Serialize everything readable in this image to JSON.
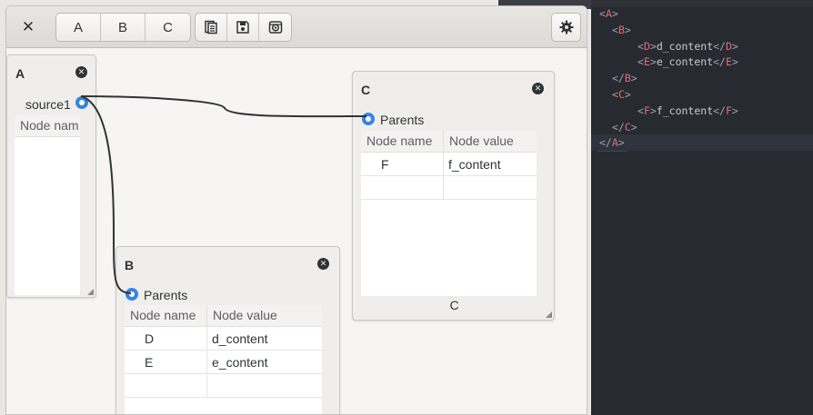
{
  "toolbar": {
    "close_label": "✕",
    "tabs": [
      "A",
      "B",
      "C"
    ],
    "icons": [
      "document-icon",
      "save-icon",
      "package-icon"
    ],
    "settings_icon": "gear-icon"
  },
  "nodes": {
    "a": {
      "title": "A",
      "port_label": "source1",
      "col_header": "Node nam"
    },
    "b": {
      "title": "B",
      "port_label": "Parents",
      "headers": [
        "Node name",
        "Node value"
      ],
      "rows": [
        {
          "name": "D",
          "value": "d_content"
        },
        {
          "name": "E",
          "value": "e_content"
        }
      ]
    },
    "c": {
      "title": "C",
      "port_label": "Parents",
      "headers": [
        "Node name",
        "Node value"
      ],
      "rows": [
        {
          "name": "F",
          "value": "f_content"
        }
      ],
      "footer": "C"
    }
  },
  "code": {
    "lines": [
      {
        "indent": "",
        "tag": "A",
        "open": true,
        "text": ""
      },
      {
        "indent": "  ",
        "tag": "B",
        "open": true,
        "text": ""
      },
      {
        "indent": "      ",
        "tag": "D",
        "open": true,
        "text": "d_content",
        "close": "D"
      },
      {
        "indent": "      ",
        "tag": "E",
        "open": true,
        "text": "e_content",
        "close": "E"
      },
      {
        "indent": "  ",
        "tag": "B",
        "open": false,
        "text": ""
      },
      {
        "indent": "  ",
        "tag": "C",
        "open": true,
        "text": ""
      },
      {
        "indent": "      ",
        "tag": "F",
        "open": true,
        "text": "f_content",
        "close": "F"
      },
      {
        "indent": "  ",
        "tag": "C",
        "open": false,
        "text": ""
      },
      {
        "indent": "",
        "tag": "A",
        "open": false,
        "text": ""
      }
    ]
  },
  "colors": {
    "accent": "#3584e4",
    "code_tag": "#e06c75",
    "code_bg": "#272a30"
  }
}
